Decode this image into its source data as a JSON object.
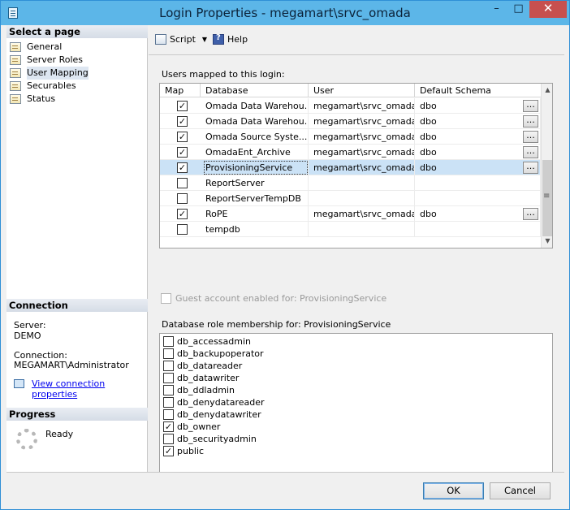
{
  "window": {
    "title": "Login Properties - megamart\\srvc_omada",
    "minimize": "–",
    "maximize": "□",
    "close": "✕"
  },
  "left": {
    "select_page_title": "Select a page",
    "pages": [
      {
        "label": "General",
        "icon": "page-icon"
      },
      {
        "label": "Server Roles",
        "icon": "page-icon"
      },
      {
        "label": "User Mapping",
        "icon": "page-icon",
        "selected": true
      },
      {
        "label": "Securables",
        "icon": "page-icon"
      },
      {
        "label": "Status",
        "icon": "page-icon"
      }
    ],
    "connection_title": "Connection",
    "server_label": "Server:",
    "server_value": "DEMO",
    "connection_label": "Connection:",
    "connection_value": "MEGAMART\\Administrator",
    "view_link": "View connection properties",
    "progress_title": "Progress",
    "progress_status": "Ready"
  },
  "toolbar": {
    "script_label": "Script",
    "help_label": "Help"
  },
  "main": {
    "users_label": "Users mapped to this login:",
    "columns": [
      "Map",
      "Database",
      "User",
      "Default Schema"
    ],
    "rows": [
      {
        "map": true,
        "database": "Omada Data Warehou...",
        "user": "megamart\\srvc_omada",
        "schema": "dbo",
        "has_button": true
      },
      {
        "map": true,
        "database": "Omada Data Warehou...",
        "user": "megamart\\srvc_omada",
        "schema": "dbo",
        "has_button": true
      },
      {
        "map": true,
        "database": "Omada Source Syste...",
        "user": "megamart\\srvc_omada",
        "schema": "dbo",
        "has_button": true
      },
      {
        "map": true,
        "database": "OmadaEnt_Archive",
        "user": "megamart\\srvc_omada",
        "schema": "dbo",
        "has_button": true
      },
      {
        "map": true,
        "database": "ProvisioningService",
        "user": "megamart\\srvc_omada",
        "schema": "dbo",
        "has_button": true,
        "selected": true
      },
      {
        "map": false,
        "database": "ReportServer",
        "user": "",
        "schema": "",
        "has_button": false
      },
      {
        "map": false,
        "database": "ReportServerTempDB",
        "user": "",
        "schema": "",
        "has_button": false
      },
      {
        "map": true,
        "database": "RoPE",
        "user": "megamart\\srvc_omada",
        "schema": "dbo",
        "has_button": true
      },
      {
        "map": false,
        "database": "tempdb",
        "user": "",
        "schema": "",
        "has_button": false
      }
    ],
    "ellipsis": "...",
    "guest_label": "Guest account enabled for: ProvisioningService",
    "roles_label": "Database role membership for: ProvisioningService",
    "roles": [
      {
        "name": "db_accessadmin",
        "checked": false
      },
      {
        "name": "db_backupoperator",
        "checked": false
      },
      {
        "name": "db_datareader",
        "checked": false
      },
      {
        "name": "db_datawriter",
        "checked": false
      },
      {
        "name": "db_ddladmin",
        "checked": false
      },
      {
        "name": "db_denydatareader",
        "checked": false
      },
      {
        "name": "db_denydatawriter",
        "checked": false
      },
      {
        "name": "db_owner",
        "checked": true
      },
      {
        "name": "db_securityadmin",
        "checked": false
      },
      {
        "name": "public",
        "checked": true
      }
    ]
  },
  "footer": {
    "ok_label": "OK",
    "cancel_label": "Cancel"
  }
}
